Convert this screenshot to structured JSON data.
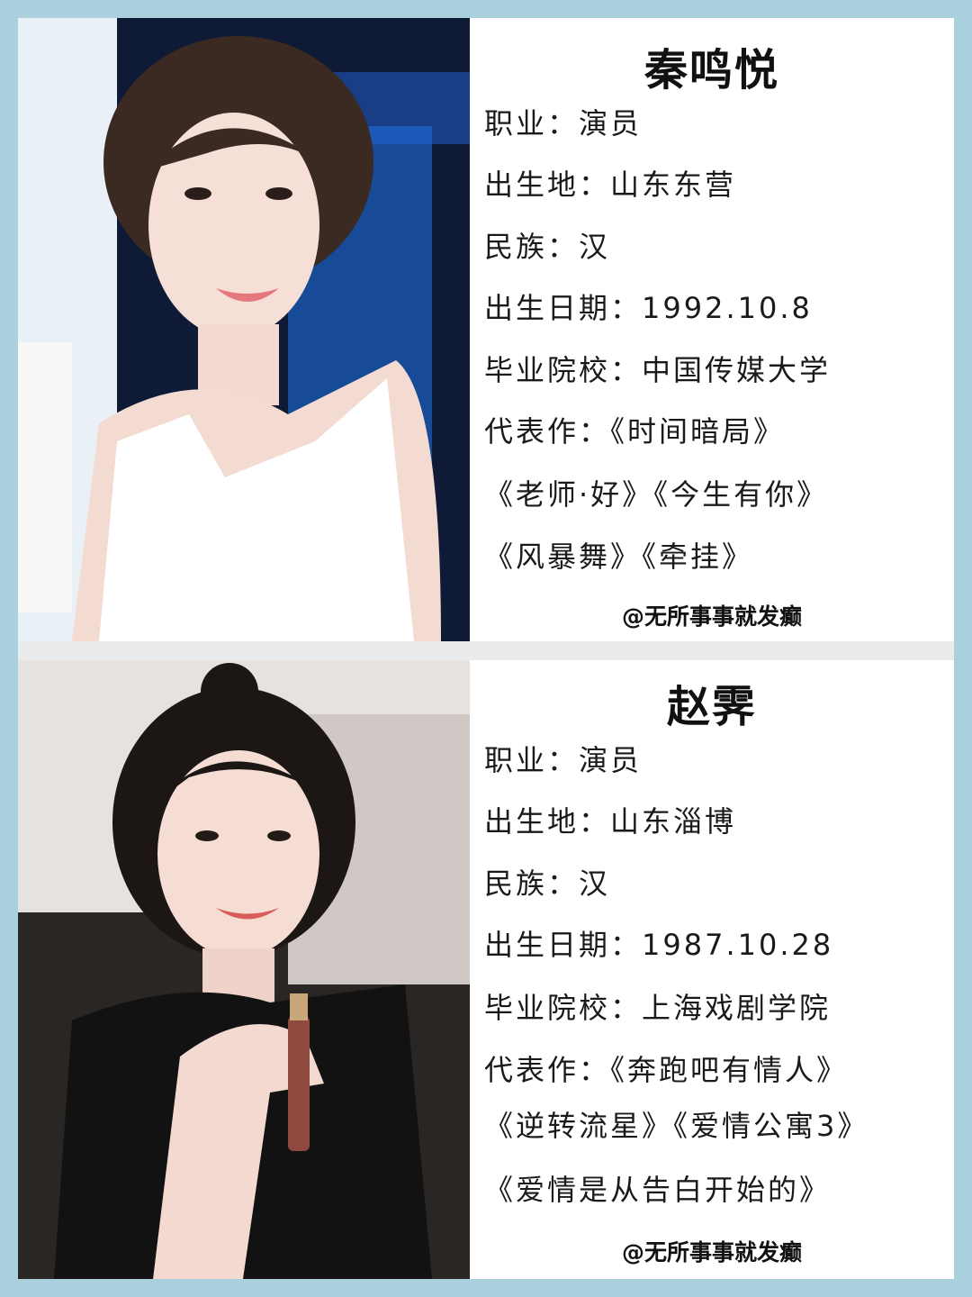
{
  "frame_color": "#a9d0dc",
  "profiles": [
    {
      "name": "秦鸣悦",
      "lines": [
        "职业：演员",
        "出生地：山东东营",
        "民族：汉",
        "出生日期：1992.10.8",
        "毕业院校：中国传媒大学",
        "代表作：《时间暗局》",
        "《老师·好》《今生有你》",
        "《风暴舞》《牵挂》"
      ],
      "watermark": "@无所事事就发癫",
      "photo": "portrait-short-hair-white-top"
    },
    {
      "name": "赵霁",
      "lines": [
        "职业：演员",
        "出生地：山东淄博",
        "民族：汉",
        "出生日期：1987.10.28",
        "毕业院校：上海戏剧学院",
        "代表作：《奔跑吧有情人》",
        "《逆转流星》《爱情公寓3》",
        "《爱情是从告白开始的》"
      ],
      "watermark": "@无所事事就发癫",
      "photo": "portrait-hair-bun-black-top"
    }
  ]
}
